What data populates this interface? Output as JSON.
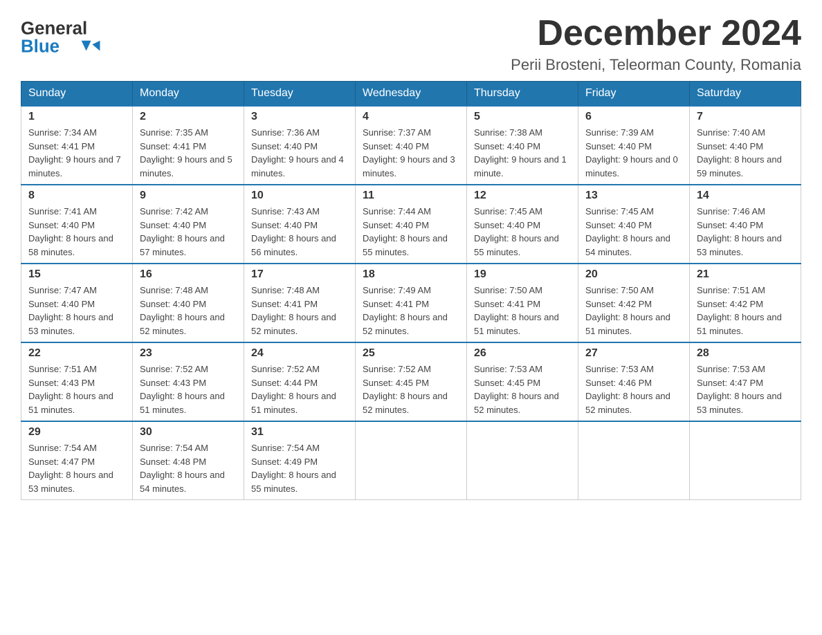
{
  "logo": {
    "general_text": "General",
    "blue_text": "Blue"
  },
  "title": "December 2024",
  "subtitle": "Perii Brosteni, Teleorman County, Romania",
  "days_of_week": [
    "Sunday",
    "Monday",
    "Tuesday",
    "Wednesday",
    "Thursday",
    "Friday",
    "Saturday"
  ],
  "weeks": [
    [
      {
        "day": "1",
        "sunrise": "7:34 AM",
        "sunset": "4:41 PM",
        "daylight": "9 hours and 7 minutes."
      },
      {
        "day": "2",
        "sunrise": "7:35 AM",
        "sunset": "4:41 PM",
        "daylight": "9 hours and 5 minutes."
      },
      {
        "day": "3",
        "sunrise": "7:36 AM",
        "sunset": "4:40 PM",
        "daylight": "9 hours and 4 minutes."
      },
      {
        "day": "4",
        "sunrise": "7:37 AM",
        "sunset": "4:40 PM",
        "daylight": "9 hours and 3 minutes."
      },
      {
        "day": "5",
        "sunrise": "7:38 AM",
        "sunset": "4:40 PM",
        "daylight": "9 hours and 1 minute."
      },
      {
        "day": "6",
        "sunrise": "7:39 AM",
        "sunset": "4:40 PM",
        "daylight": "9 hours and 0 minutes."
      },
      {
        "day": "7",
        "sunrise": "7:40 AM",
        "sunset": "4:40 PM",
        "daylight": "8 hours and 59 minutes."
      }
    ],
    [
      {
        "day": "8",
        "sunrise": "7:41 AM",
        "sunset": "4:40 PM",
        "daylight": "8 hours and 58 minutes."
      },
      {
        "day": "9",
        "sunrise": "7:42 AM",
        "sunset": "4:40 PM",
        "daylight": "8 hours and 57 minutes."
      },
      {
        "day": "10",
        "sunrise": "7:43 AM",
        "sunset": "4:40 PM",
        "daylight": "8 hours and 56 minutes."
      },
      {
        "day": "11",
        "sunrise": "7:44 AM",
        "sunset": "4:40 PM",
        "daylight": "8 hours and 55 minutes."
      },
      {
        "day": "12",
        "sunrise": "7:45 AM",
        "sunset": "4:40 PM",
        "daylight": "8 hours and 55 minutes."
      },
      {
        "day": "13",
        "sunrise": "7:45 AM",
        "sunset": "4:40 PM",
        "daylight": "8 hours and 54 minutes."
      },
      {
        "day": "14",
        "sunrise": "7:46 AM",
        "sunset": "4:40 PM",
        "daylight": "8 hours and 53 minutes."
      }
    ],
    [
      {
        "day": "15",
        "sunrise": "7:47 AM",
        "sunset": "4:40 PM",
        "daylight": "8 hours and 53 minutes."
      },
      {
        "day": "16",
        "sunrise": "7:48 AM",
        "sunset": "4:40 PM",
        "daylight": "8 hours and 52 minutes."
      },
      {
        "day": "17",
        "sunrise": "7:48 AM",
        "sunset": "4:41 PM",
        "daylight": "8 hours and 52 minutes."
      },
      {
        "day": "18",
        "sunrise": "7:49 AM",
        "sunset": "4:41 PM",
        "daylight": "8 hours and 52 minutes."
      },
      {
        "day": "19",
        "sunrise": "7:50 AM",
        "sunset": "4:41 PM",
        "daylight": "8 hours and 51 minutes."
      },
      {
        "day": "20",
        "sunrise": "7:50 AM",
        "sunset": "4:42 PM",
        "daylight": "8 hours and 51 minutes."
      },
      {
        "day": "21",
        "sunrise": "7:51 AM",
        "sunset": "4:42 PM",
        "daylight": "8 hours and 51 minutes."
      }
    ],
    [
      {
        "day": "22",
        "sunrise": "7:51 AM",
        "sunset": "4:43 PM",
        "daylight": "8 hours and 51 minutes."
      },
      {
        "day": "23",
        "sunrise": "7:52 AM",
        "sunset": "4:43 PM",
        "daylight": "8 hours and 51 minutes."
      },
      {
        "day": "24",
        "sunrise": "7:52 AM",
        "sunset": "4:44 PM",
        "daylight": "8 hours and 51 minutes."
      },
      {
        "day": "25",
        "sunrise": "7:52 AM",
        "sunset": "4:45 PM",
        "daylight": "8 hours and 52 minutes."
      },
      {
        "day": "26",
        "sunrise": "7:53 AM",
        "sunset": "4:45 PM",
        "daylight": "8 hours and 52 minutes."
      },
      {
        "day": "27",
        "sunrise": "7:53 AM",
        "sunset": "4:46 PM",
        "daylight": "8 hours and 52 minutes."
      },
      {
        "day": "28",
        "sunrise": "7:53 AM",
        "sunset": "4:47 PM",
        "daylight": "8 hours and 53 minutes."
      }
    ],
    [
      {
        "day": "29",
        "sunrise": "7:54 AM",
        "sunset": "4:47 PM",
        "daylight": "8 hours and 53 minutes."
      },
      {
        "day": "30",
        "sunrise": "7:54 AM",
        "sunset": "4:48 PM",
        "daylight": "8 hours and 54 minutes."
      },
      {
        "day": "31",
        "sunrise": "7:54 AM",
        "sunset": "4:49 PM",
        "daylight": "8 hours and 55 minutes."
      },
      null,
      null,
      null,
      null
    ]
  ],
  "labels": {
    "sunrise_prefix": "Sunrise: ",
    "sunset_prefix": "Sunset: ",
    "daylight_prefix": "Daylight: "
  }
}
